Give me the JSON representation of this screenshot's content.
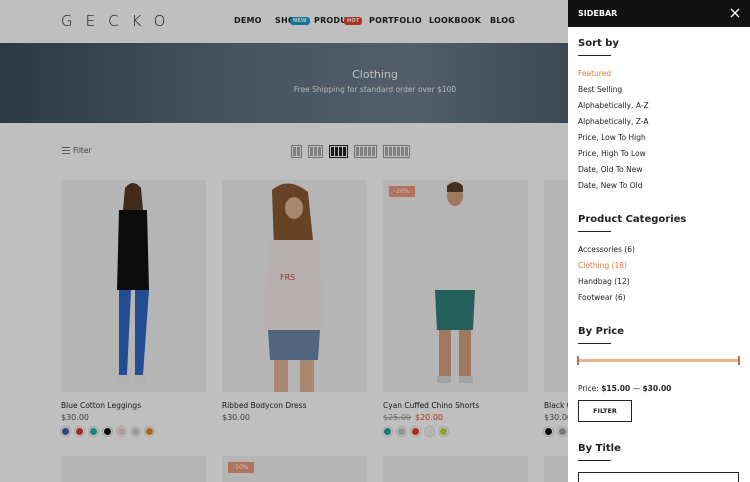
{
  "header": {
    "logo": "GECKO",
    "nav": [
      {
        "label": "DEMO"
      },
      {
        "label": "SHOP",
        "badge": "NEW",
        "badge_color": "#1aa1c7"
      },
      {
        "label": "PRODUCT",
        "badge": "HOT",
        "badge_color": "#e6452c"
      },
      {
        "label": "PORTFOLIO"
      },
      {
        "label": "LOOKBOOK"
      },
      {
        "label": "BLOG"
      }
    ]
  },
  "hero": {
    "title": "Clothing",
    "subtitle": "Free Shipping for standard order over $100"
  },
  "toolbar": {
    "filter_label": "Filter"
  },
  "products": [
    {
      "name": "Blue Cotton Leggings",
      "price": "$30.00",
      "swatches": [
        "#3d5fa8",
        "#d83a2a",
        "#1fb4a8",
        "#111111",
        "#f2c8c8",
        "#c8cfd6",
        "#e08a18"
      ]
    },
    {
      "name": "Ribbed Bodycon Dress",
      "price": "$30.00",
      "swatches": []
    },
    {
      "name": "Cyan Cuffed Chino Shorts",
      "old_price": "$25.00",
      "new_price": "$20.00",
      "sale": "-20%",
      "swatches": [
        "#1ba79a",
        "#c5c5c5",
        "#e2431e",
        "#efefef",
        "#b5da3a"
      ]
    },
    {
      "name": "Black C",
      "price": "$30.00",
      "swatches": [
        "#111111",
        "#a0a0a0"
      ]
    }
  ],
  "row2_sale": "-50%",
  "sidebar": {
    "title": "SIDEBAR",
    "sort": {
      "heading": "Sort by",
      "options": [
        "Featured",
        "Best Selling",
        "Alphabetically, A-Z",
        "Alphabetically, Z-A",
        "Price, Low To High",
        "Price, High To Low",
        "Date, Old To New",
        "Date, New To Old"
      ],
      "active": "Featured"
    },
    "categories": {
      "heading": "Product Categories",
      "items": [
        "Accessories (6)",
        "Clothing (18)",
        "Handbag (12)",
        "Footwear (6)"
      ],
      "active": "Clothing (18)"
    },
    "price": {
      "heading": "By Price",
      "label": "Price:",
      "min": "$15.00",
      "sep": "—",
      "max": "$30.00",
      "button": "FILTER",
      "accent": "#e8b48f"
    },
    "by_title": {
      "heading": "By Title"
    }
  }
}
